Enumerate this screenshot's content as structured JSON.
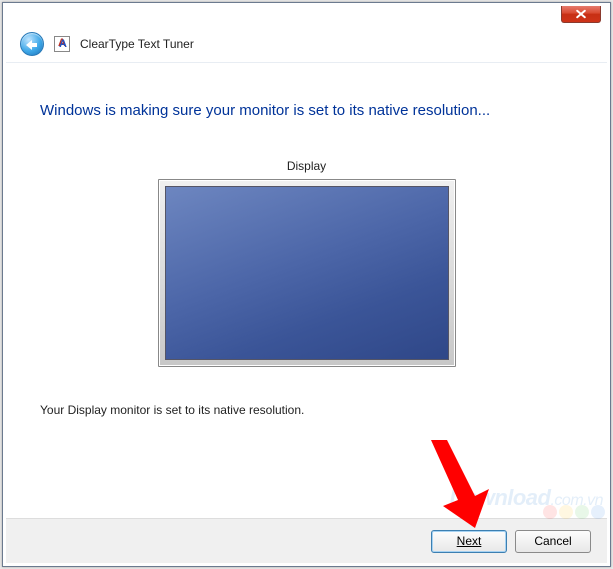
{
  "window": {
    "title": "ClearType Text Tuner"
  },
  "heading": "Windows is making sure your monitor is set to its native resolution...",
  "display_label": "Display",
  "status": "Your Display monitor is set to its native resolution.",
  "buttons": {
    "next": "Next",
    "cancel": "Cancel"
  },
  "watermark": "Download",
  "watermark_suffix": ".com.vn"
}
